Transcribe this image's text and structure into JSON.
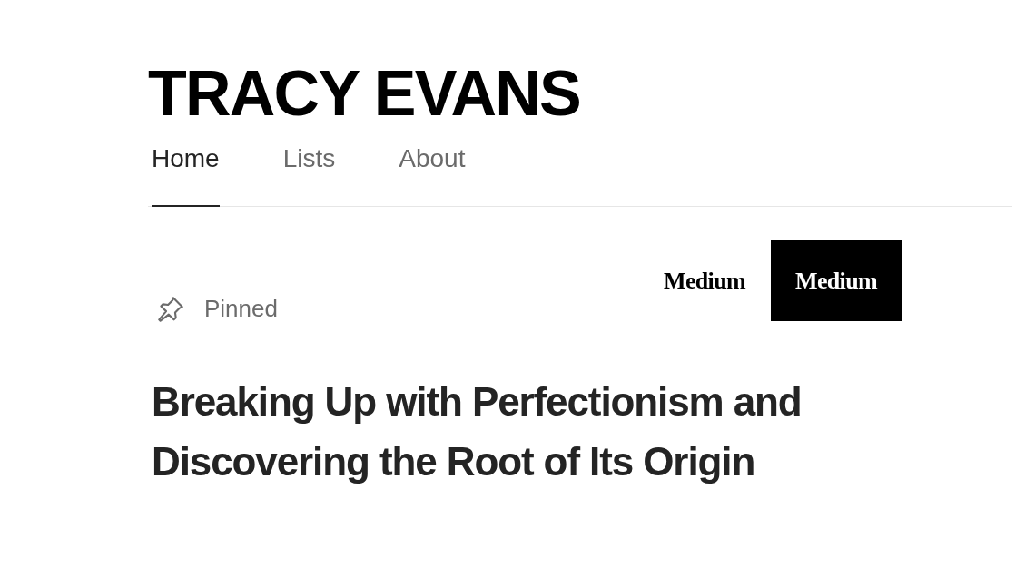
{
  "profile": {
    "name": "TRACY EVANS"
  },
  "tabs": [
    {
      "label": "Home",
      "selected": true
    },
    {
      "label": "Lists",
      "selected": false
    },
    {
      "label": "About",
      "selected": false
    }
  ],
  "logos": [
    {
      "label": "Medium",
      "kind": "light"
    },
    {
      "label": "Medium",
      "kind": "dark"
    }
  ],
  "pinned": {
    "label": "Pinned"
  },
  "article": {
    "title": "Breaking Up with Perfectionism and Discovering the Root of Its Origin"
  }
}
